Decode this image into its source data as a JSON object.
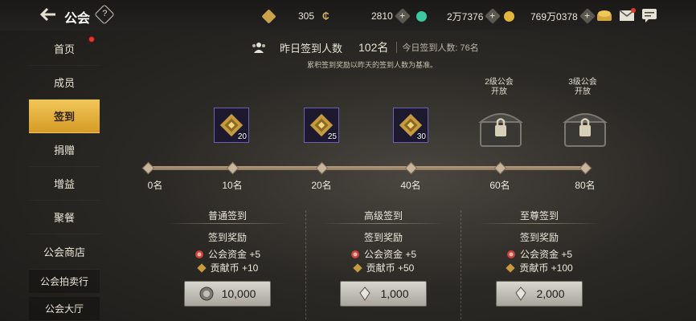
{
  "topbar": {
    "title": "公会",
    "help_label": "?",
    "resources": [
      {
        "icon": "gold-emblem-icon",
        "value": "305"
      },
      {
        "icon": "copper-coin-icon",
        "value": "2810"
      },
      {
        "icon": "jade-icon",
        "value": "2万7376"
      },
      {
        "icon": "gold-coin-icon",
        "value": "769万0378"
      }
    ]
  },
  "sidebar": {
    "items": [
      {
        "label": "首页"
      },
      {
        "label": "成员"
      },
      {
        "label": "签到"
      },
      {
        "label": "捐赠"
      },
      {
        "label": "增益"
      },
      {
        "label": "聚餐"
      },
      {
        "label": "公会商店"
      },
      {
        "label": "公会拍卖行"
      },
      {
        "label": "公会大厅"
      }
    ]
  },
  "header": {
    "yesterday_label": "昨日签到人数",
    "yesterday_value": "102名",
    "today_label": "今日签到人数: 76名",
    "note": "累积签到奖励以昨天的签到人数为基准。"
  },
  "progress": {
    "milestones": [
      "0名",
      "10名",
      "20名",
      "40名",
      "60名",
      "80名"
    ],
    "rewards": [
      {
        "count": "20"
      },
      {
        "count": "25"
      },
      {
        "count": "30"
      }
    ],
    "locked": [
      {
        "line1": "2级公会",
        "line2": "开放"
      },
      {
        "line1": "3级公会",
        "line2": "开放"
      }
    ]
  },
  "tiers": [
    {
      "title": "普通签到",
      "sub": "签到奖励",
      "r1": "公会资金 +5",
      "r2": "贡献币 +10",
      "cost": "10,000"
    },
    {
      "title": "高级签到",
      "sub": "签到奖励",
      "r1": "公会资金 +5",
      "r2": "贡献币 +50",
      "cost": "1,000"
    },
    {
      "title": "至尊签到",
      "sub": "签到奖励",
      "r1": "公会资金 +5",
      "r2": "贡献币 +100",
      "cost": "2,000"
    }
  ],
  "colors": {
    "accent": "#e0a73a",
    "track": "#a68f74",
    "box_border": "#6f5fb0"
  }
}
